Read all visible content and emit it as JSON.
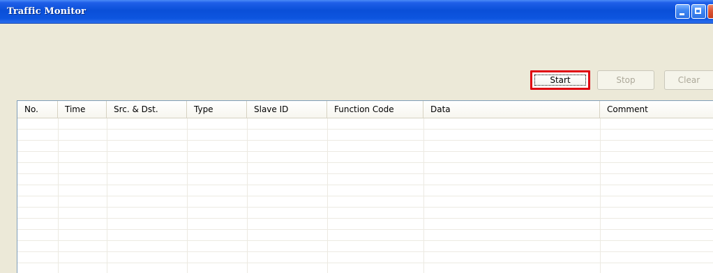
{
  "window": {
    "title": "Traffic Monitor",
    "title_buttons": {
      "minimize_icon": "minimize-icon",
      "maximize_icon": "maximize-icon",
      "close_icon": "close-icon"
    },
    "colors": {
      "title_bar": "#0a4fd8",
      "window_bg": "#ece9d8",
      "highlight_border": "#e00010"
    }
  },
  "toolbar": {
    "start_label": "Start",
    "stop_label": "Stop",
    "clear_label": "Clear",
    "start_highlighted": true,
    "stop_enabled": false,
    "clear_enabled": false
  },
  "table": {
    "columns": [
      "No.",
      "Time",
      "Src. & Dst.",
      "Type",
      "Slave ID",
      "Function Code",
      "Data",
      "Comment"
    ],
    "rows": []
  }
}
